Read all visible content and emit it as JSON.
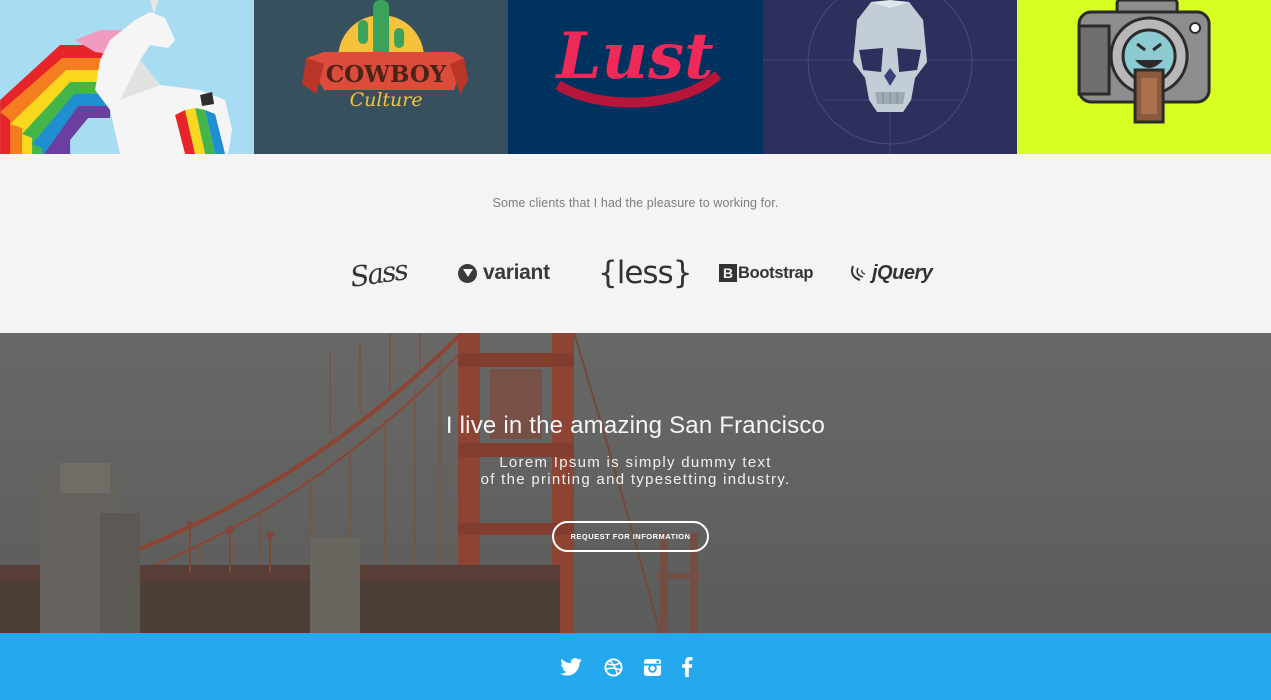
{
  "portfolio": {
    "tiles": [
      {
        "name": "Unicorn rainbow",
        "bg": "#a8dcf2"
      },
      {
        "name": "Cowboy Culture",
        "bg": "#36505e",
        "text_top": "COWBOY",
        "text_bottom": "Culture"
      },
      {
        "name": "Lust",
        "bg": "#00325f",
        "text": "Lust"
      },
      {
        "name": "Skull",
        "bg": "#2e2f5c"
      },
      {
        "name": "Camera",
        "bg": "#d6ff22"
      }
    ]
  },
  "clients": {
    "caption": "Some clients that I had the pleasure to working for.",
    "logos": [
      {
        "name": "Sass",
        "label": "Sass"
      },
      {
        "name": "variant",
        "label": "variant"
      },
      {
        "name": "less",
        "label": "{less}"
      },
      {
        "name": "Bootstrap",
        "icon_letter": "B",
        "label": "Bootstrap"
      },
      {
        "name": "jQuery",
        "label": "jQuery"
      }
    ]
  },
  "hero": {
    "title": "I live in the amazing San Francisco",
    "subtitle_line1": "Lorem Ipsum is simply dummy text",
    "subtitle_line2": "of the printing and typesetting industry.",
    "button_label": "REQUEST FOR INFORMATION"
  },
  "footer": {
    "bg": "#25a9ee",
    "social": [
      {
        "name": "twitter-icon"
      },
      {
        "name": "dribbble-icon"
      },
      {
        "name": "instagram-icon"
      },
      {
        "name": "facebook-icon"
      }
    ]
  },
  "colors": {
    "accent": "#25a9ee",
    "clients_bg": "#f4f4f4",
    "bridge": "#a8432c"
  }
}
